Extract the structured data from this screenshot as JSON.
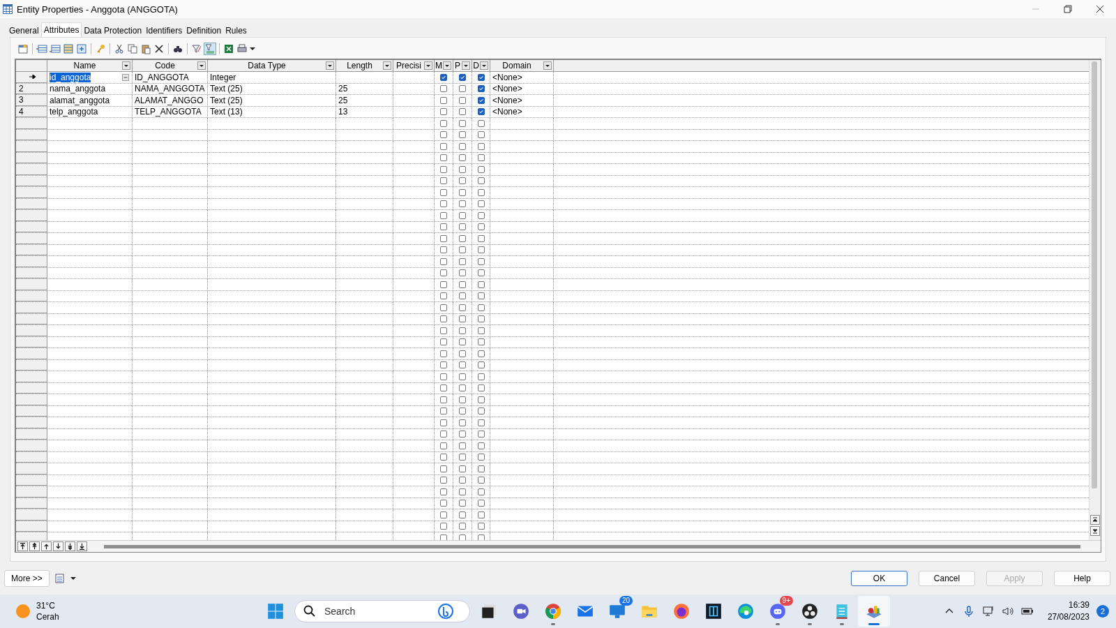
{
  "window": {
    "title": "Entity Properties - Anggota (ANGGOTA)"
  },
  "tabs": [
    {
      "label": "General",
      "selected": false
    },
    {
      "label": "Attributes",
      "selected": true
    },
    {
      "label": "Data Protection",
      "selected": false
    },
    {
      "label": "Identifiers",
      "selected": false
    },
    {
      "label": "Definition",
      "selected": false
    },
    {
      "label": "Rules",
      "selected": false
    }
  ],
  "grid": {
    "columns": [
      "Name",
      "Code",
      "Data Type",
      "Length",
      "Precisi",
      "M",
      "P",
      "D",
      "Domain"
    ],
    "rows": [
      {
        "current": true,
        "name": "id_anggota",
        "code": "ID_ANGGOTA",
        "data_type": "Integer",
        "m": true,
        "p": true,
        "d": true,
        "domain": "<None>"
      },
      {
        "current": false,
        "number": "2",
        "name": "nama_anggota",
        "code": "NAMA_ANGGOTA",
        "data_type": "Text (25)",
        "length": "25",
        "m": false,
        "p": false,
        "d": true,
        "domain": "<None>"
      },
      {
        "current": false,
        "number": "3",
        "name": "alamat_anggota",
        "code": "ALAMAT_ANGGO",
        "data_type": "Text (25)",
        "length": "25",
        "m": false,
        "p": false,
        "d": true,
        "domain": "<None>"
      },
      {
        "current": false,
        "number": "4",
        "name": "telp_anggota",
        "code": "TELP_ANGGOTA",
        "data_type": "Text (13)",
        "length": "13",
        "m": false,
        "p": false,
        "d": true,
        "domain": "<None>"
      }
    ],
    "blank_rows": [
      {
        "m": false,
        "p": false,
        "d": false
      },
      {
        "m": false,
        "p": false,
        "d": false
      },
      {
        "m": false,
        "p": false,
        "d": false
      },
      {
        "m": false,
        "p": false,
        "d": false
      },
      {
        "m": false,
        "p": false,
        "d": false
      },
      {
        "m": false,
        "p": false,
        "d": false
      },
      {
        "m": false,
        "p": false,
        "d": false
      },
      {
        "m": false,
        "p": false,
        "d": false
      },
      {
        "m": false,
        "p": false,
        "d": false
      },
      {
        "m": false,
        "p": false,
        "d": false
      },
      {
        "m": false,
        "p": false,
        "d": false
      },
      {
        "m": false,
        "p": false,
        "d": false
      },
      {
        "m": false,
        "p": false,
        "d": false
      },
      {
        "m": false,
        "p": false,
        "d": false
      },
      {
        "m": false,
        "p": false,
        "d": false
      },
      {
        "m": false,
        "p": false,
        "d": false
      },
      {
        "m": false,
        "p": false,
        "d": false
      },
      {
        "m": false,
        "p": false,
        "d": false
      },
      {
        "m": false,
        "p": false,
        "d": false
      },
      {
        "m": false,
        "p": false,
        "d": false
      },
      {
        "m": false,
        "p": false,
        "d": false
      },
      {
        "m": false,
        "p": false,
        "d": false
      },
      {
        "m": false,
        "p": false,
        "d": false
      },
      {
        "m": false,
        "p": false,
        "d": false
      },
      {
        "m": false,
        "p": false,
        "d": false
      },
      {
        "m": false,
        "p": false,
        "d": false
      },
      {
        "m": false,
        "p": false,
        "d": false
      },
      {
        "m": false,
        "p": false,
        "d": false
      },
      {
        "m": false,
        "p": false,
        "d": false
      },
      {
        "m": false,
        "p": false,
        "d": false
      },
      {
        "m": false,
        "p": false,
        "d": false
      },
      {
        "m": false,
        "p": false,
        "d": false
      },
      {
        "m": false,
        "p": false,
        "d": false
      },
      {
        "m": false,
        "p": false,
        "d": false
      },
      {
        "m": false,
        "p": false,
        "d": false
      },
      {
        "m": false,
        "p": false,
        "d": false
      },
      {
        "m": false,
        "p": false,
        "d": false
      }
    ]
  },
  "footer": {
    "more": "More >>",
    "buttons": [
      {
        "label": "OK",
        "default": true,
        "disabled": false
      },
      {
        "label": "Cancel",
        "default": false,
        "disabled": false
      },
      {
        "label": "Apply",
        "default": false,
        "disabled": true
      },
      {
        "label": "Help",
        "default": false,
        "disabled": false
      }
    ]
  },
  "taskbar": {
    "weather": {
      "temperature": "31°C",
      "condition": "Cerah"
    },
    "search": {
      "placeholder": "Search"
    },
    "apps": [
      {
        "kind": "taskview",
        "running": false,
        "active": false
      },
      {
        "kind": "video",
        "running": false,
        "active": false
      },
      {
        "kind": "chrome",
        "running": true,
        "active": false
      },
      {
        "kind": "mail",
        "running": false,
        "active": false
      },
      {
        "kind": "store",
        "badge": "20",
        "running": false,
        "active": false
      },
      {
        "kind": "folder",
        "running": false,
        "active": false
      },
      {
        "kind": "firefox",
        "running": false,
        "active": false
      },
      {
        "kind": "dark",
        "running": false,
        "active": false
      },
      {
        "kind": "edge",
        "running": false,
        "active": false
      },
      {
        "kind": "discord",
        "badge": "9+",
        "running": true,
        "active": false
      },
      {
        "kind": "obs",
        "running": true,
        "active": false
      },
      {
        "kind": "notepad",
        "running": true,
        "active": false
      },
      {
        "kind": "designer",
        "running": true,
        "active": true
      }
    ],
    "time": "16:39",
    "date": "27/08/2023",
    "notifications": "2"
  }
}
